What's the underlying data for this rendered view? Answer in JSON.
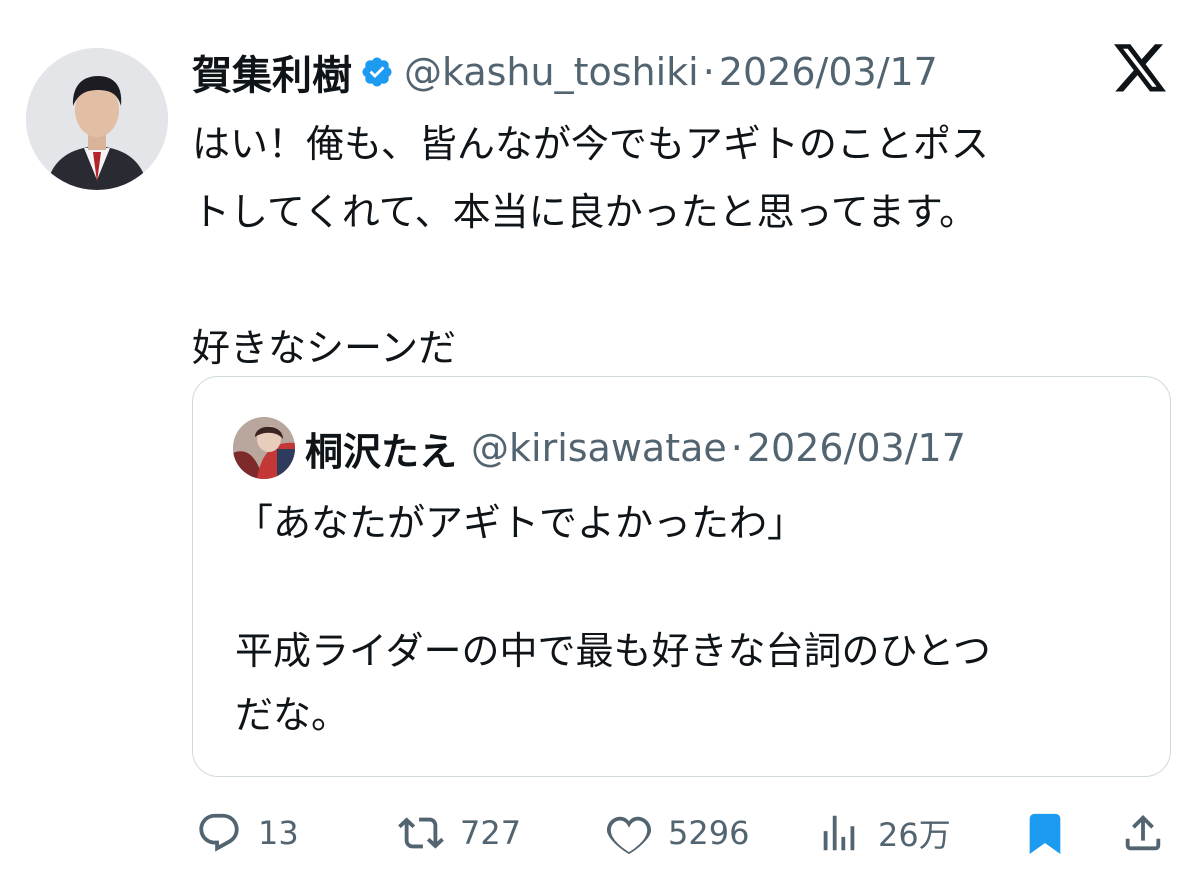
{
  "post": {
    "author_name": "賀集利樹",
    "author_handle": "@kashu_toshiki",
    "separator": "·",
    "date": "2026/03/17",
    "verified": true,
    "text_lines": [
      "はい！俺も、皆んなが今でもアギトのことポス",
      "トしてくれて、本当に良かったと思ってます。",
      "",
      "好きなシーンだ"
    ]
  },
  "quote": {
    "author_name": "桐沢たえ",
    "author_handle": "@kirisawatae",
    "separator": "·",
    "date": "2026/03/17",
    "text_lines": [
      "「あなたがアギトでよかったわ」",
      "",
      "平成ライダーの中で最も好きな台詞のひとつ",
      "だな。"
    ]
  },
  "actions": {
    "reply_count": "13",
    "retweet_count": "727",
    "like_count": "5296",
    "views_count": "26万"
  },
  "icons": {
    "verified": "verified-badge-icon",
    "logo": "x-logo-icon",
    "reply": "reply-icon",
    "retweet": "retweet-icon",
    "like": "heart-icon",
    "views": "views-icon",
    "bookmark": "bookmark-icon",
    "share": "share-icon"
  },
  "colors": {
    "text": "#0f1419",
    "secondary": "#536471",
    "accent": "#1d9bf0",
    "border": "#cfd9de"
  }
}
